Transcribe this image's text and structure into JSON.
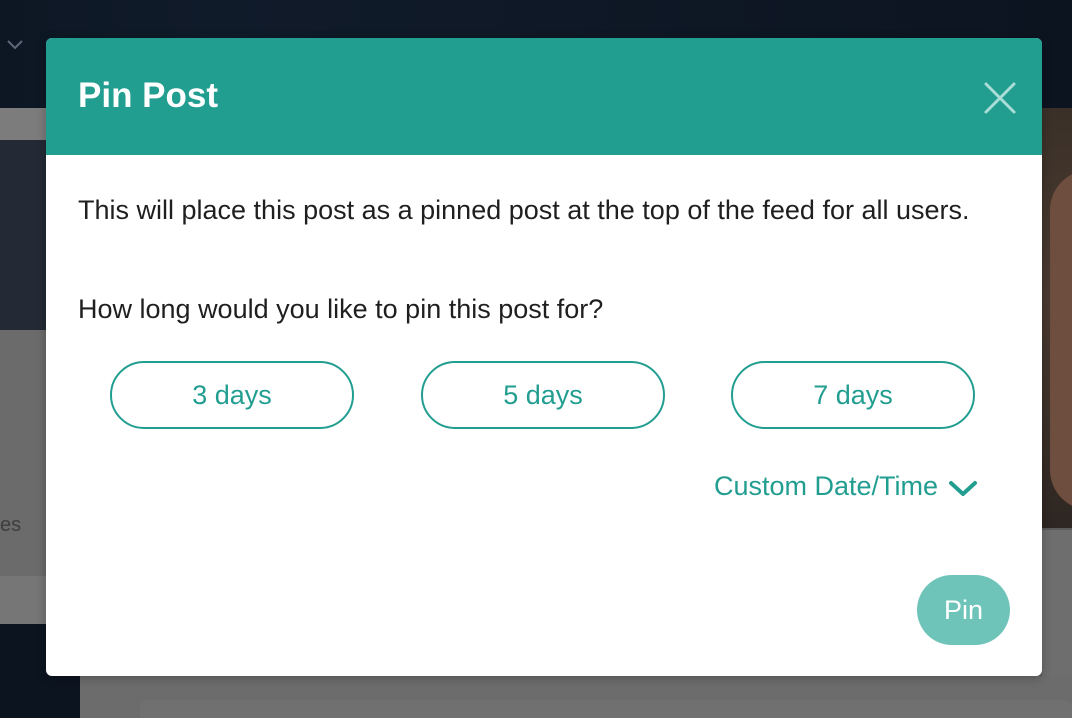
{
  "background": {
    "left_fragment": "es"
  },
  "modal": {
    "title": "Pin Post",
    "close_icon": "close-icon",
    "description": "This will place this post as a pinned post at the top of the feed for all users.",
    "question": "How long would you like to pin this post for?",
    "durations": [
      {
        "label": "3 days"
      },
      {
        "label": "5 days"
      },
      {
        "label": "7 days"
      }
    ],
    "custom_toggle": {
      "label": "Custom Date/Time",
      "icon": "chevron-down-icon"
    },
    "pin_label": "Pin"
  },
  "colors": {
    "accent": "#229e91",
    "pin_button_disabled": "#6fc4ba",
    "text": "#1f1f1f"
  }
}
